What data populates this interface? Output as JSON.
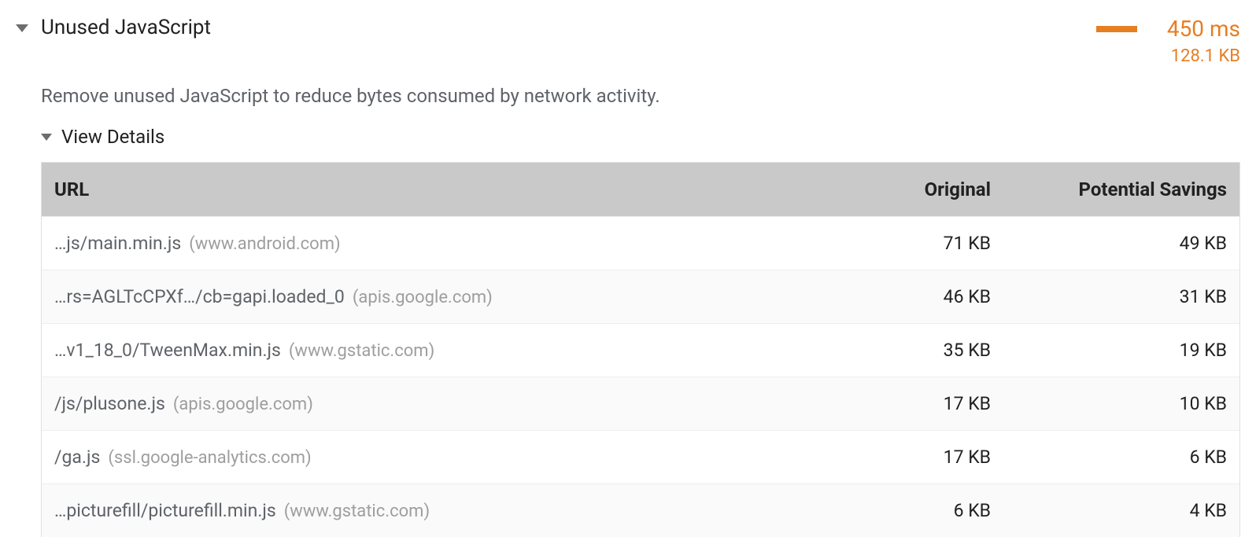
{
  "audit": {
    "title": "Unused JavaScript",
    "description": "Remove unused JavaScript to reduce bytes consumed by network activity.",
    "time_label": "450 ms",
    "size_label": "128.1 KB",
    "details_label": "View Details"
  },
  "table": {
    "headers": {
      "url": "URL",
      "original": "Original",
      "savings": "Potential Savings"
    },
    "rows": [
      {
        "path": "…js/main.min.js",
        "host": "(www.android.com)",
        "original": "71 KB",
        "savings": "49 KB"
      },
      {
        "path": "…rs=AGLTcCPXf…/cb=gapi.loaded_0",
        "host": "(apis.google.com)",
        "original": "46 KB",
        "savings": "31 KB"
      },
      {
        "path": "…v1_18_0/TweenMax.min.js",
        "host": "(www.gstatic.com)",
        "original": "35 KB",
        "savings": "19 KB"
      },
      {
        "path": "/js/plusone.js",
        "host": "(apis.google.com)",
        "original": "17 KB",
        "savings": "10 KB"
      },
      {
        "path": "/ga.js",
        "host": "(ssl.google-analytics.com)",
        "original": "17 KB",
        "savings": "6 KB"
      },
      {
        "path": "…picturefill/picturefill.min.js",
        "host": "(www.gstatic.com)",
        "original": "6 KB",
        "savings": "4 KB"
      }
    ]
  }
}
